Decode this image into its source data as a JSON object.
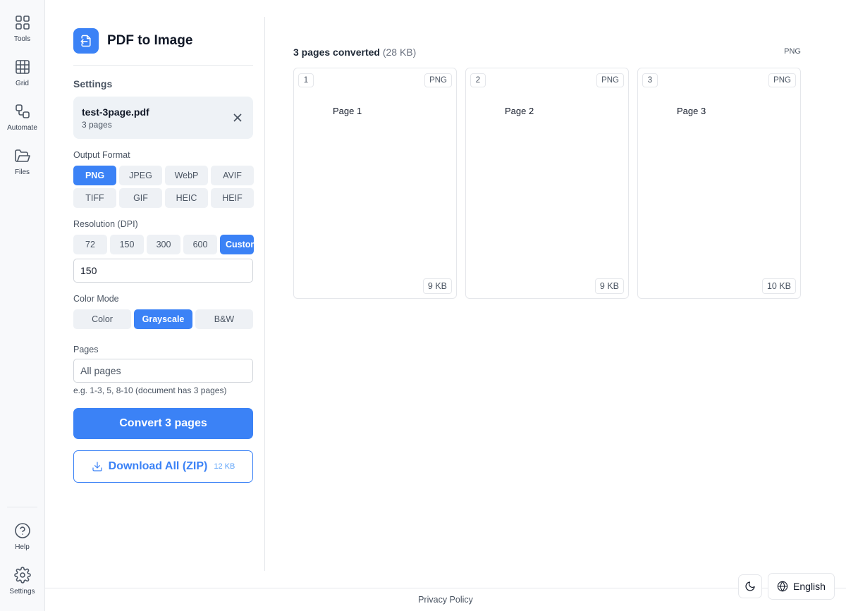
{
  "colors": {
    "accent": "#3b82f6",
    "rail_bg": "#f8f9fb",
    "border": "#e5e7eb"
  },
  "rail": {
    "top_items": [
      {
        "label": "Tools",
        "icon": "grid-2x2-icon"
      },
      {
        "label": "Grid",
        "icon": "table-grid-icon"
      },
      {
        "label": "Automate",
        "icon": "workflow-icon"
      },
      {
        "label": "Files",
        "icon": "folder-open-icon"
      }
    ],
    "bottom_items": [
      {
        "label": "Help",
        "icon": "help-circle-icon"
      },
      {
        "label": "Settings",
        "icon": "gear-icon"
      }
    ]
  },
  "panel": {
    "title": "PDF to Image",
    "settings_heading": "Settings",
    "file": {
      "name": "test-3page.pdf",
      "pages": "3 pages"
    },
    "output_format": {
      "label": "Output Format",
      "options": [
        "PNG",
        "JPEG",
        "WebP",
        "AVIF",
        "TIFF",
        "GIF",
        "HEIC",
        "HEIF"
      ],
      "selected": "PNG"
    },
    "resolution": {
      "label": "Resolution (DPI)",
      "options": [
        "72",
        "150",
        "300",
        "600",
        "Custom"
      ],
      "selected": "Custom",
      "custom_value": "150"
    },
    "color_mode": {
      "label": "Color Mode",
      "options": [
        "Color",
        "Grayscale",
        "B&W"
      ],
      "selected": "Grayscale"
    },
    "pages": {
      "label": "Pages",
      "placeholder": "All pages",
      "hint": "e.g. 1-3, 5, 8-10 (document has 3 pages)"
    },
    "convert_label": "Convert 3 pages",
    "download": {
      "label": "Download All (ZIP)",
      "size": "12 KB"
    }
  },
  "main": {
    "summary_count": "3 pages converted",
    "summary_size": "(28 KB)",
    "format": "PNG",
    "pages": [
      {
        "number": "1",
        "format": "PNG",
        "text": "Page 1",
        "size": "9 KB"
      },
      {
        "number": "2",
        "format": "PNG",
        "text": "Page 2",
        "size": "9 KB"
      },
      {
        "number": "3",
        "format": "PNG",
        "text": "Page 3",
        "size": "10 KB"
      }
    ]
  },
  "footer": {
    "privacy": "Privacy Policy",
    "language": "English"
  }
}
